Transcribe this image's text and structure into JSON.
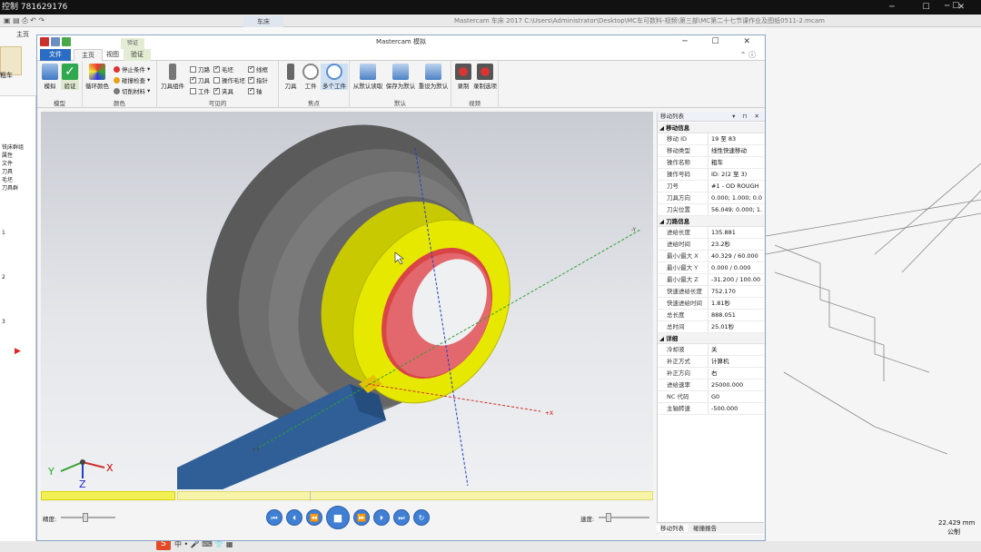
{
  "outer": {
    "title": "控制 781629176"
  },
  "bg_app": {
    "tab_home": "主页",
    "path": "Mastercam 车床 2017  C:\\Users\\Administrator\\Desktop\\MC车可数料-视频\\第三部\\MC第二十七节课作业及图纸0511-2.mcam",
    "right_tab": "车床",
    "left_items": [
      "粗车",
      "铣床群组",
      "属性",
      "文件",
      "刀具",
      "毛坯",
      "刀具群",
      "1",
      "2",
      "3"
    ],
    "scale_readout": "22.429 mm",
    "scale_unit": "公制"
  },
  "sim": {
    "title": "Mastercam 模拟",
    "context_tab": "验证",
    "tabs": {
      "file": "文件",
      "home": "主页",
      "view": "视图",
      "verify": "验证"
    },
    "groups": {
      "model": {
        "label": "模型",
        "buttons": [
          "模拟",
          "验证"
        ]
      },
      "color": {
        "label": "颜色",
        "big": "循环颜色",
        "items": [
          "停止条件",
          "碰撞检查",
          "切削材料"
        ]
      },
      "visible": {
        "label": "可见的",
        "big": "刀具组件",
        "checks": [
          {
            "text": "刀路",
            "on": false
          },
          {
            "text": "毛坯",
            "on": true
          },
          {
            "text": "线框",
            "on": true
          },
          {
            "text": "刀具",
            "on": true
          },
          {
            "text": "操作毛坯",
            "on": false
          },
          {
            "text": "指针",
            "on": true
          },
          {
            "text": "工件",
            "on": false
          },
          {
            "text": "夹具",
            "on": true
          },
          {
            "text": "轴",
            "on": true
          }
        ]
      },
      "focus": {
        "label": "焦点",
        "buttons": [
          "刀具",
          "工件",
          "多个工件"
        ]
      },
      "default": {
        "label": "默认",
        "buttons": [
          "从默认读取",
          "保存为默认",
          "重设为默认"
        ]
      },
      "record": {
        "label": "视频",
        "buttons": [
          "录制",
          "录制选项"
        ]
      }
    },
    "controls": {
      "precision_label": "精度:",
      "speed_label": "速度:"
    },
    "panel": {
      "title": "移动列表",
      "sections": [
        {
          "name": "移动信息",
          "rows": [
            [
              "移动 ID",
              "19 至 83"
            ],
            [
              "移动类型",
              "线性快速移动"
            ],
            [
              "操作名称",
              "粗车"
            ],
            [
              "操作号码",
              "ID: 2(2 至 3)"
            ],
            [
              "刀号",
              "#1 - OD ROUGH"
            ],
            [
              "刀具方向",
              "0.000; 1.000; 0.0"
            ],
            [
              "刀尖位置",
              "56.049; 0.000; 1."
            ]
          ]
        },
        {
          "name": "刀路信息",
          "rows": [
            [
              "进给长度",
              "135.881"
            ],
            [
              "进给时间",
              "23.2秒"
            ],
            [
              "最小/最大 X",
              "40.329 / 60.000"
            ],
            [
              "最小/最大 Y",
              "0.000 / 0.000"
            ],
            [
              "最小/最大 Z",
              "-31.200 / 100.00"
            ],
            [
              "快速进给长度",
              "752.170"
            ],
            [
              "快速进给时间",
              "1.81秒"
            ],
            [
              "总长度",
              "888.051"
            ],
            [
              "总时间",
              "25.01秒"
            ]
          ]
        },
        {
          "name": "详细",
          "rows": [
            [
              "冷却液",
              "关"
            ],
            [
              "补正方式",
              "计算机"
            ],
            [
              "补正方向",
              "右"
            ],
            [
              "进给速率",
              "25000.000"
            ],
            [
              "NC 代码",
              "G0"
            ],
            [
              "主轴转速",
              "-500.000"
            ]
          ]
        }
      ],
      "bottom_tabs": [
        "移动列表",
        "碰撞报告"
      ]
    },
    "axis_labels": {
      "x": "X",
      "y": "Y",
      "z": "Z",
      "plus_x": "+X",
      "minus_y": "-Y",
      "plus_y": "+Y"
    }
  },
  "colors": {
    "accent": "#2b6cc4",
    "part_yellow": "#e6e800",
    "tool_blue": "#2f5f96",
    "bore_red": "#e2686e",
    "disk_gray": "#6a6a6a"
  }
}
